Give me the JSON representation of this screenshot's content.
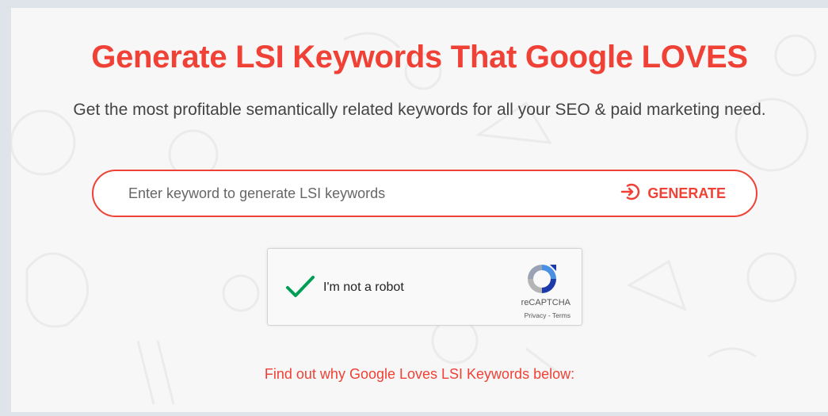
{
  "hero": {
    "title": "Generate LSI Keywords That Google LOVES",
    "subtitle": "Get the most profitable semantically related keywords for all your SEO & paid marketing need."
  },
  "search": {
    "placeholder": "Enter keyword to generate LSI keywords",
    "value": "",
    "button_label": "GENERATE",
    "button_icon": "arrow-circle-icon"
  },
  "captcha": {
    "label": "I'm not a robot",
    "checked": true,
    "brand": "reCAPTCHA",
    "links": "Privacy - Terms"
  },
  "footer_link": "Find out why Google Loves LSI Keywords below:",
  "colors": {
    "accent": "#ef4136",
    "background": "#f7f7f7",
    "check": "#009e55"
  }
}
